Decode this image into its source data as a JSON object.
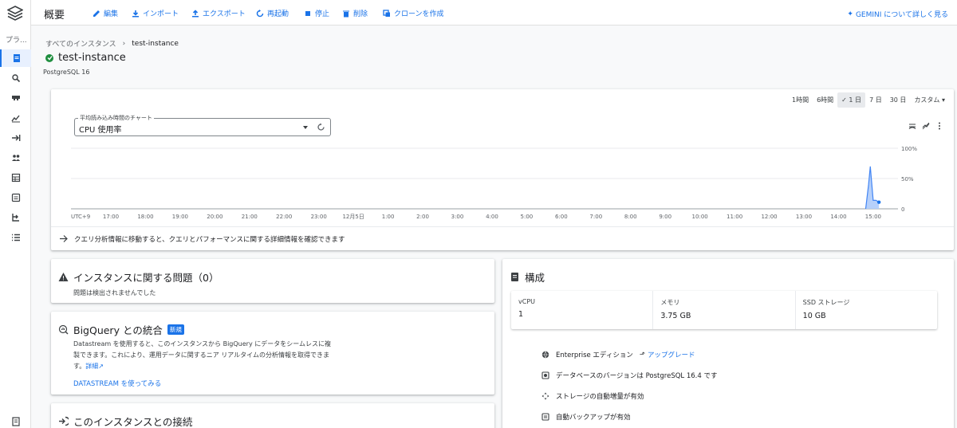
{
  "rail": {
    "title": "プラ...",
    "items": [
      "overview-icon",
      "query-icon",
      "connections-icon",
      "metrics-icon",
      "migration-icon",
      "users-icon",
      "databases-icon",
      "backups-icon",
      "replicas-icon",
      "operations-icon"
    ],
    "bottom": "release-notes-icon"
  },
  "toolbar": {
    "title": "概要",
    "edit": "編集",
    "import": "インポート",
    "export": "エクスポート",
    "restart": "再起動",
    "stop": "停止",
    "delete": "削除",
    "clone": "クローンを作成",
    "gemini": "GEMINI について詳しく見る"
  },
  "breadcrumb": {
    "all": "すべてのインスタンス",
    "current": "test-instance"
  },
  "instance": {
    "name": "test-instance",
    "version": "PostgreSQL 16"
  },
  "chart_card": {
    "ranges": [
      "1時間",
      "6時間",
      "1 日",
      "7 日",
      "30 日",
      "カスタム"
    ],
    "selected_range": "1 日",
    "select_label": "平均読み込み時間のチャート",
    "select_value": "CPU 使用率",
    "note": "クエリ分析情報に移動すると、クエリとパフォーマンスに関する詳細情報を確認できます"
  },
  "chart_data": {
    "type": "area",
    "x_ticks": [
      "UTC+9",
      "17:00",
      "18:00",
      "19:00",
      "20:00",
      "21:00",
      "22:00",
      "23:00",
      "12月5日",
      "1:00",
      "2:00",
      "3:00",
      "4:00",
      "5:00",
      "6:00",
      "7:00",
      "8:00",
      "9:00",
      "10:00",
      "11:00",
      "12:00",
      "13:00",
      "14:00",
      "15:00"
    ],
    "y_ticks": [
      "100%",
      "50%",
      "0"
    ],
    "ylim": [
      0,
      100
    ],
    "series": [
      {
        "x": [
          "14:47",
          "14:52",
          "14:55",
          "15:00",
          "15:05",
          "15:10"
        ],
        "values": [
          0,
          40,
          70,
          14,
          14,
          11
        ]
      }
    ],
    "accent_color": "#4285f4"
  },
  "issues": {
    "title": "インスタンスに関する問題（0）",
    "text": "問題は検出されませんでした"
  },
  "bigquery": {
    "title": "BigQuery との統合",
    "badge": "新規",
    "text": "Datastream を使用すると、このインスタンスから BigQuery にデータをシームレスに複製できます。これにより、運用データに関するニア リアルタイムの分析情報を取得できます。",
    "link": "詳細",
    "action": "DATASTREAM を使ってみる"
  },
  "connect": {
    "title": "このインスタンスとの接続"
  },
  "config": {
    "title": "構成",
    "specs": [
      {
        "key": "vCPU",
        "value": "1"
      },
      {
        "key": "メモリ",
        "value": "3.75 GB"
      },
      {
        "key": "SSD ストレージ",
        "value": "10 GB"
      }
    ],
    "edition": "Enterprise エディション",
    "upgrade": "アップグレード",
    "db_version": "データベースのバージョンは PostgreSQL 16.4 です",
    "storage": "ストレージの自動増量が有効",
    "backup": "自動バックアップが有効"
  }
}
